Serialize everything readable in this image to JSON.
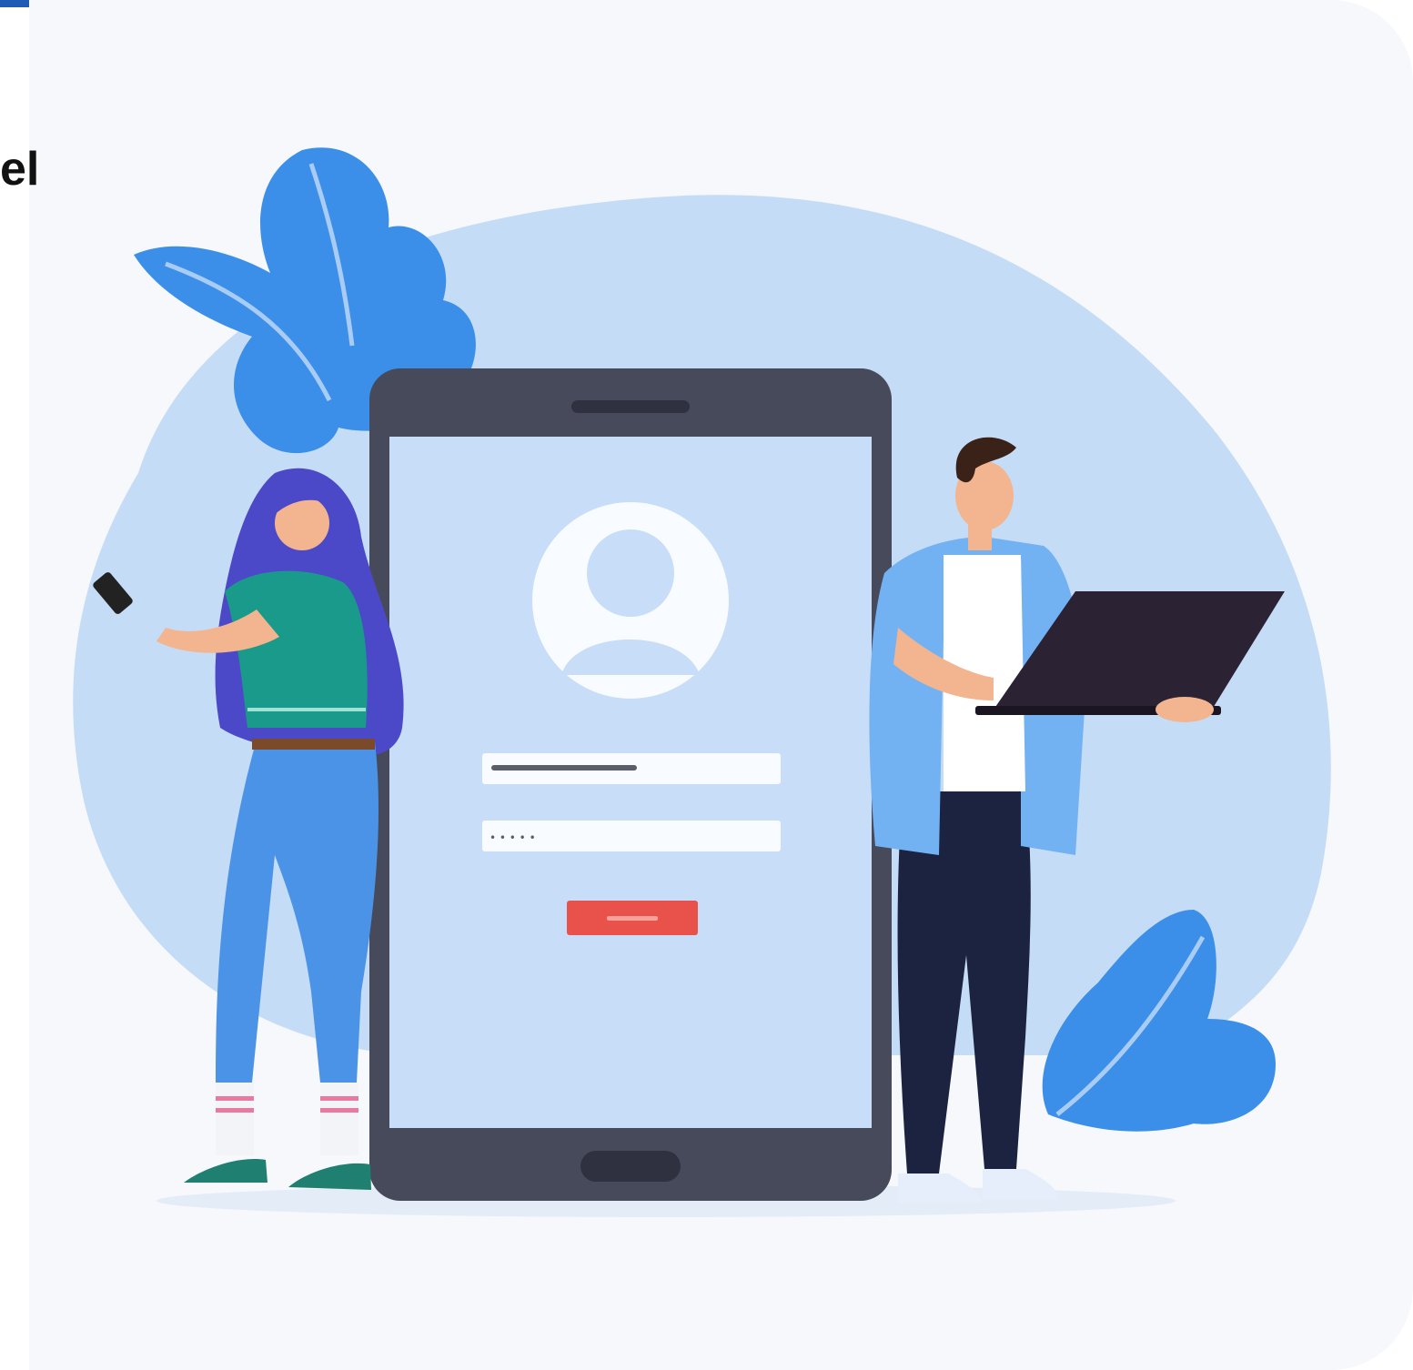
{
  "heading_fragment": "el",
  "colors": {
    "accent": "#1f5bb5",
    "card_background": "#f6f8fc",
    "blob": "#c5dcf7",
    "leaf": "#3b8fe8",
    "phone_frame": "#474a5a",
    "phone_screen": "#c7ddf8",
    "login_button": "#e9524a",
    "laptop": "#2b2233",
    "woman_hair": "#4b49c7",
    "woman_top": "#1a9a8a",
    "jeans": "#4a93e6",
    "man_shirt": "#73b2f2",
    "man_pants": "#1c2340"
  },
  "illustration": {
    "password_mask": "• • • • •"
  }
}
